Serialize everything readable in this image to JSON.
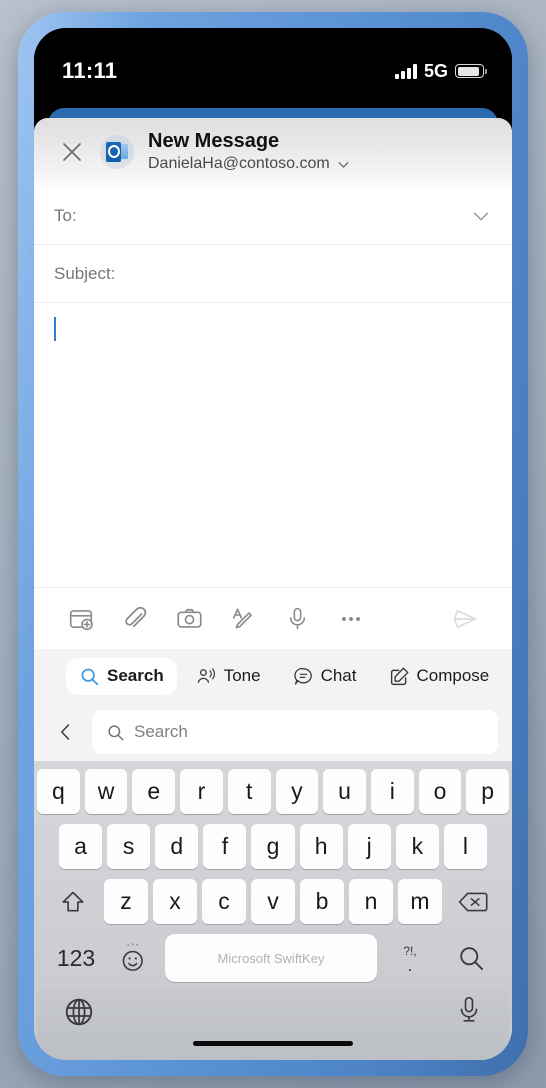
{
  "status_bar": {
    "time": "11:11",
    "network": "5G",
    "signal_icon": "signal-bars-icon",
    "battery_icon": "battery-icon"
  },
  "compose": {
    "close_icon": "close-icon",
    "app_icon": "outlook-icon",
    "title": "New Message",
    "from_address": "DanielaHa@contoso.com",
    "from_chevron_icon": "chevron-down-icon",
    "to_label": "To:",
    "to_expand_icon": "chevron-down-icon",
    "subject_label": "Subject:",
    "body_text": "",
    "caret_color": "#2d7dd2"
  },
  "attach_toolbar": {
    "items": [
      {
        "name": "calendar-add-icon",
        "label": "Add calendar event"
      },
      {
        "name": "paperclip-icon",
        "label": "Attach file"
      },
      {
        "name": "camera-icon",
        "label": "Camera"
      },
      {
        "name": "format-text-icon",
        "label": "Format text"
      },
      {
        "name": "microphone-icon",
        "label": "Dictate"
      },
      {
        "name": "more-horizontal-icon",
        "label": "More options"
      }
    ],
    "send": {
      "name": "send-icon",
      "label": "Send"
    }
  },
  "copilot_tabs": {
    "items": [
      {
        "label": "Search",
        "icon": "search-icon",
        "active": true
      },
      {
        "label": "Tone",
        "icon": "tone-icon",
        "active": false
      },
      {
        "label": "Chat",
        "icon": "chat-bubble-icon",
        "active": false
      },
      {
        "label": "Compose",
        "icon": "compose-edit-icon",
        "active": false
      }
    ]
  },
  "search_row": {
    "back_icon": "chevron-left-icon",
    "search_icon": "search-icon",
    "value": "",
    "placeholder": "Search"
  },
  "keyboard": {
    "row1": [
      "q",
      "w",
      "e",
      "r",
      "t",
      "y",
      "u",
      "i",
      "o",
      "p"
    ],
    "row2": [
      "a",
      "s",
      "d",
      "f",
      "g",
      "h",
      "j",
      "k",
      "l"
    ],
    "row3": [
      "z",
      "x",
      "c",
      "v",
      "b",
      "n",
      "m"
    ],
    "shift_icon": "shift-icon",
    "backspace_icon": "backspace-icon",
    "numbers_key": "123",
    "emoji_icon": "emoji-icon",
    "space_label": "Microsoft SwiftKey",
    "punct_key_top": "?!,",
    "punct_key_bottom": ".",
    "enter_icon": "search-icon",
    "globe_icon": "globe-icon",
    "dictation_icon": "microphone-icon"
  },
  "colors": {
    "accent_blue": "#2d7dd2",
    "sheet_blue": "#2a6bb0",
    "keyboard_bg": "#cfd1d6",
    "tab_strip_bg": "#f3f3f6"
  }
}
